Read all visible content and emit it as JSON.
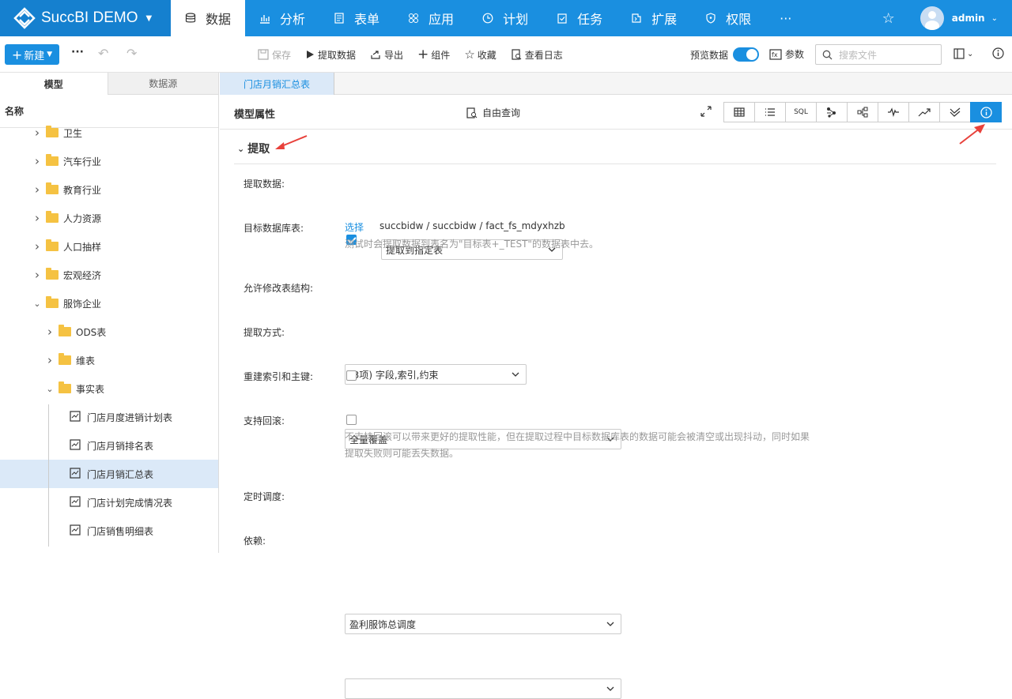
{
  "app": {
    "brand": "SuccBI DEMO"
  },
  "nav": [
    {
      "label": "数据",
      "icon": "database-icon",
      "active": true
    },
    {
      "label": "分析",
      "icon": "chart-icon"
    },
    {
      "label": "表单",
      "icon": "form-icon"
    },
    {
      "label": "应用",
      "icon": "apps-icon"
    },
    {
      "label": "计划",
      "icon": "clock-icon"
    },
    {
      "label": "任务",
      "icon": "task-icon"
    },
    {
      "label": "扩展",
      "icon": "extension-icon"
    },
    {
      "label": "权限",
      "icon": "shield-icon"
    },
    {
      "label": "···",
      "icon": "more-icon"
    }
  ],
  "user": {
    "name": "admin"
  },
  "toolbar": {
    "new_label": "新建",
    "save_label": "保存",
    "extract_label": "提取数据",
    "export_label": "导出",
    "component_label": "组件",
    "favorite_label": "收藏",
    "log_label": "查看日志",
    "preview_label": "预览数据",
    "params_label": "参数",
    "search_placeholder": "搜索文件"
  },
  "left": {
    "tabs": [
      "模型",
      "数据源"
    ],
    "header": "名称",
    "tree": [
      {
        "label": "卫生",
        "type": "folder",
        "level": 1,
        "expanded": false
      },
      {
        "label": "汽车行业",
        "type": "folder",
        "level": 1,
        "expanded": false
      },
      {
        "label": "教育行业",
        "type": "folder",
        "level": 1,
        "expanded": false
      },
      {
        "label": "人力资源",
        "type": "folder",
        "level": 1,
        "expanded": false
      },
      {
        "label": "人口抽样",
        "type": "folder",
        "level": 1,
        "expanded": false
      },
      {
        "label": "宏观经济",
        "type": "folder",
        "level": 1,
        "expanded": false
      },
      {
        "label": "服饰企业",
        "type": "folder",
        "level": 1,
        "expanded": true
      },
      {
        "label": "ODS表",
        "type": "folder",
        "level": 2,
        "expanded": false
      },
      {
        "label": "维表",
        "type": "folder",
        "level": 2,
        "expanded": false
      },
      {
        "label": "事实表",
        "type": "folder",
        "level": 2,
        "expanded": true
      },
      {
        "label": "门店月度进销计划表",
        "type": "table",
        "level": 3
      },
      {
        "label": "门店月销排名表",
        "type": "table",
        "level": 3
      },
      {
        "label": "门店月销汇总表",
        "type": "table",
        "level": 3,
        "selected": true
      },
      {
        "label": "门店计划完成情况表",
        "type": "table",
        "level": 3
      },
      {
        "label": "门店销售明细表",
        "type": "table",
        "level": 3
      }
    ]
  },
  "main": {
    "tab": "门店月销汇总表",
    "title": "模型属性",
    "free_query": "自由查询",
    "view_buttons": [
      "table-icon",
      "list-icon",
      "SQL",
      "lineage-icon",
      "tree-icon",
      "pulse-icon",
      "trend-icon",
      "compare-icon",
      "info-icon"
    ],
    "section": "提取",
    "form": {
      "extract_label": "提取数据:",
      "extract_checked": true,
      "extract_mode": "提取到指定表",
      "target_label": "目标数据库表:",
      "target_select": "选择",
      "target_path": "succbidw / succbidw / fact_fs_mdyxhzb",
      "target_hint": "测试时会提取数据到表名为\"目标表+_TEST\"的数据表中去。",
      "allow_modify_label": "允许修改表结构:",
      "allow_modify_value": "(3项) 字段,索引,约束",
      "method_label": "提取方式:",
      "method_value": "全量覆盖",
      "rebuild_label": "重建索引和主键:",
      "rebuild_checked": false,
      "rollback_label": "支持回滚:",
      "rollback_checked": false,
      "rollback_hint_1": "不支持回滚可以带来更好的提取性能，但在提取过程中目标数据库表的数据可能会被清空或出现抖动，同时如果",
      "rollback_hint_2": "提取失败则可能丢失数据。",
      "schedule_label": "定时调度:",
      "schedule_value": "盈利服饰总调度",
      "depend_label": "依赖:",
      "depend_value": ""
    }
  },
  "colors": {
    "primary": "#1a8fe0",
    "brand_bg": "#1580cf",
    "folder": "#f5c242",
    "selected_row": "#dbe9f8",
    "annotation": "#e8413b"
  }
}
